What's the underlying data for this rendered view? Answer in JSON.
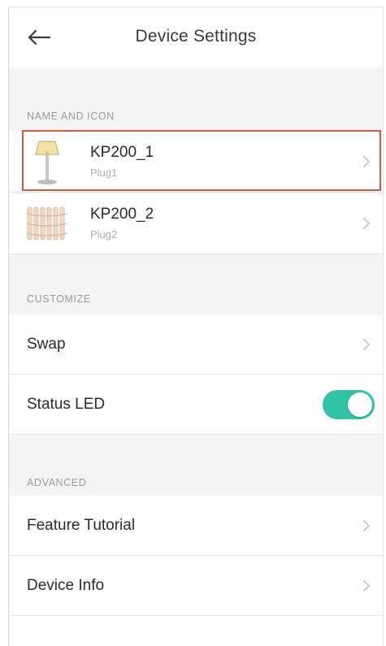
{
  "header": {
    "title": "Device Settings",
    "back_icon": "arrow-left-icon"
  },
  "sections": {
    "name_icon": {
      "label": "NAME AND ICON",
      "devices": [
        {
          "name": "KP200_1",
          "sub": "Plug1",
          "icon": "floor-lamp-icon"
        },
        {
          "name": "KP200_2",
          "sub": "Plug2",
          "icon": "string-lights-icon"
        }
      ]
    },
    "customize": {
      "label": "CUSTOMIZE",
      "swap_label": "Swap",
      "status_led_label": "Status LED",
      "status_led_on": true
    },
    "advanced": {
      "label": "ADVANCED",
      "feature_tutorial_label": "Feature Tutorial",
      "device_info_label": "Device Info"
    }
  },
  "colors": {
    "toggle_on": "#2ec4a5",
    "highlight": "#e0553d",
    "section_bg": "#f4f4f4"
  }
}
